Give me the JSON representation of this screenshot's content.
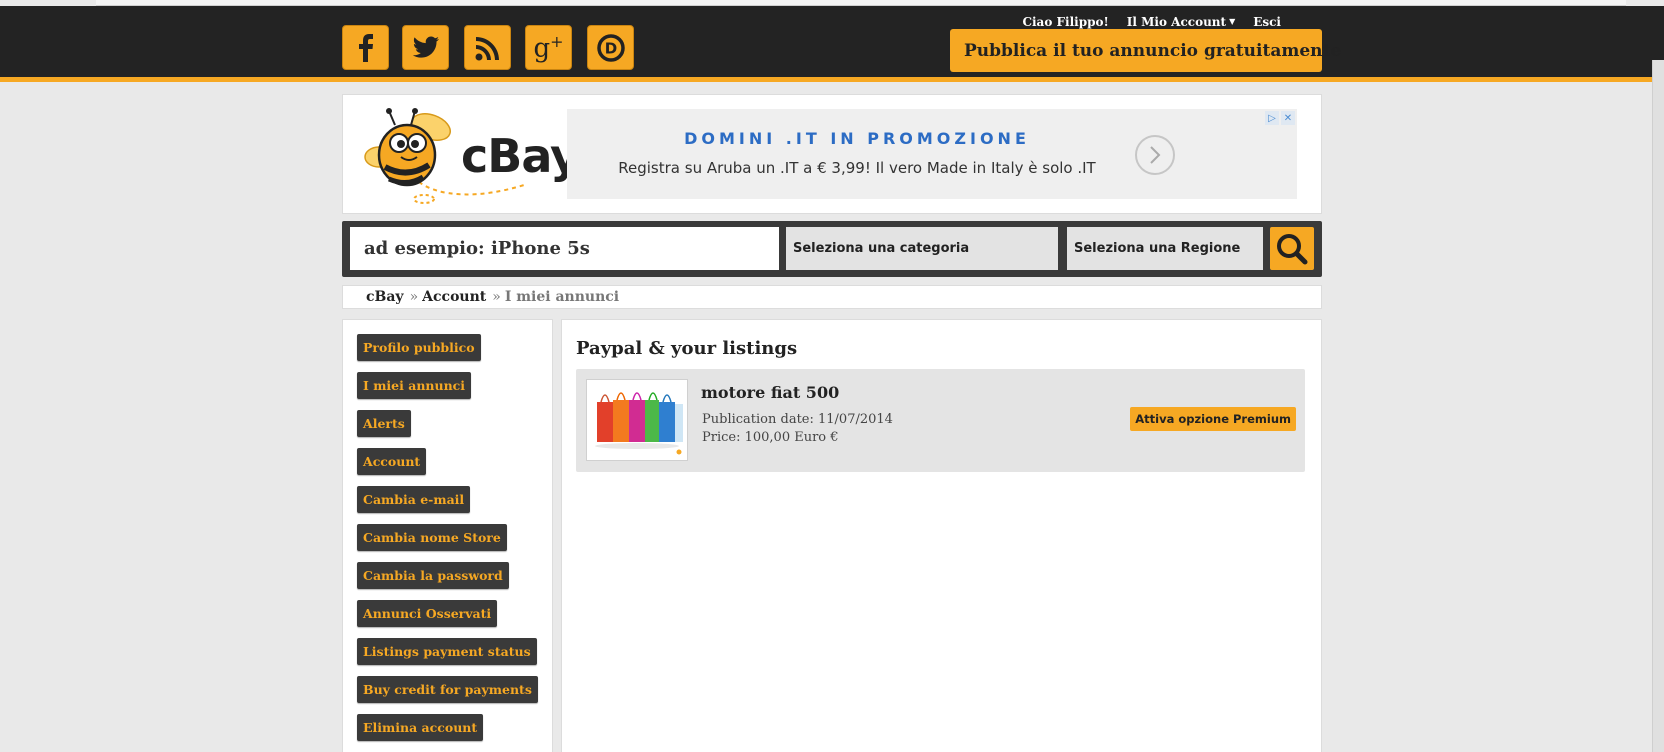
{
  "header": {
    "social": [
      {
        "name": "facebook-icon",
        "glyph": "f"
      },
      {
        "name": "twitter-icon",
        "glyph": "twitter"
      },
      {
        "name": "rss-icon",
        "glyph": "rss"
      },
      {
        "name": "google-plus-icon",
        "glyph": "g+"
      },
      {
        "name": "disqus-icon",
        "glyph": "D"
      }
    ],
    "greeting": "Ciao Filippo!",
    "my_account": "Il Mio Account",
    "logout": "Esci",
    "publish_label": "Pubblica il tuo annuncio gratuitamente",
    "accent_color": "#f6a823"
  },
  "logo": {
    "text": "cBay"
  },
  "ad": {
    "title": "DOMINI .IT IN PROMOZIONE",
    "text": "Registra su Aruba un .IT a € 3,99! Il vero Made in Italy è solo .IT"
  },
  "search": {
    "value": "ad esempio: iPhone 5s",
    "category_label": "Seleziona una categoria",
    "region_label": "Seleziona una Regione"
  },
  "breadcrumb": {
    "home": "cBay",
    "account": "Account",
    "current": "I miei annunci"
  },
  "sidebar": {
    "items": [
      "Profilo pubblico",
      "I miei annunci",
      "Alerts",
      "Account",
      "Cambia e-mail",
      "Cambia nome Store",
      "Cambia la password",
      "Annunci Osservati",
      "Listings payment status",
      "Buy credit for payments",
      "Elimina account"
    ]
  },
  "main": {
    "title": "Paypal & your listings",
    "listing": {
      "title": "motore fiat 500",
      "date": "Publication date: 11/07/2014",
      "price": "Price: 100,00 Euro €",
      "premium_label": "Attiva opzione Premium"
    }
  }
}
